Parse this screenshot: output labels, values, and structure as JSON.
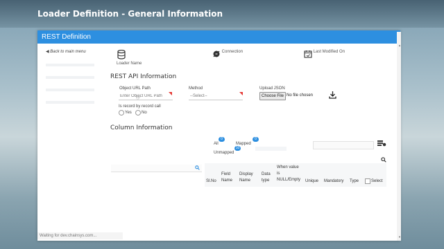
{
  "page": {
    "title": "Loader Definition - General Information"
  },
  "panel": {
    "title": "REST Definition",
    "back_label": "Back to main menu"
  },
  "steps": [
    {
      "label": "Loader Name",
      "icon": "database-icon"
    },
    {
      "label": "Connection",
      "icon": "plug-icon"
    },
    {
      "label": "Last Modified On",
      "icon": "calendar-icon"
    }
  ],
  "rest_api": {
    "section_title": "REST API Information",
    "object_url": {
      "label": "Object URL Path",
      "placeholder": "Enter Object URL Path"
    },
    "method": {
      "label": "Method",
      "value": "--Select--"
    },
    "upload": {
      "label": "Upload JSON",
      "button": "Choose File",
      "status": "No file chosen",
      "icon": "upload-icon"
    },
    "record": {
      "label": "Is record by record call",
      "options": [
        "Yes",
        "No"
      ]
    }
  },
  "column_info": {
    "section_title": "Column Information",
    "tabs": [
      {
        "label": "All",
        "count": "0"
      },
      {
        "label": "Mapped",
        "count": "0"
      },
      {
        "label": "Unmapped",
        "count": "10"
      }
    ],
    "headers": {
      "slno": "Sl.No",
      "field_name_1": "Field",
      "field_name_2": "Name",
      "display_name_1": "Display",
      "display_name_2": "Name",
      "data_type_1": "Data",
      "data_type_2": "type",
      "when_1": "When value",
      "when_2": "is",
      "when_3": "NULL/Empty",
      "unique": "Unique",
      "mandatory": "Mandatory",
      "type": "Type",
      "select": "Select"
    }
  },
  "status": {
    "text": "Waiting for dev.chainsys.com..."
  },
  "colors": {
    "accent": "#2d8fe0",
    "required": "#e53935"
  }
}
